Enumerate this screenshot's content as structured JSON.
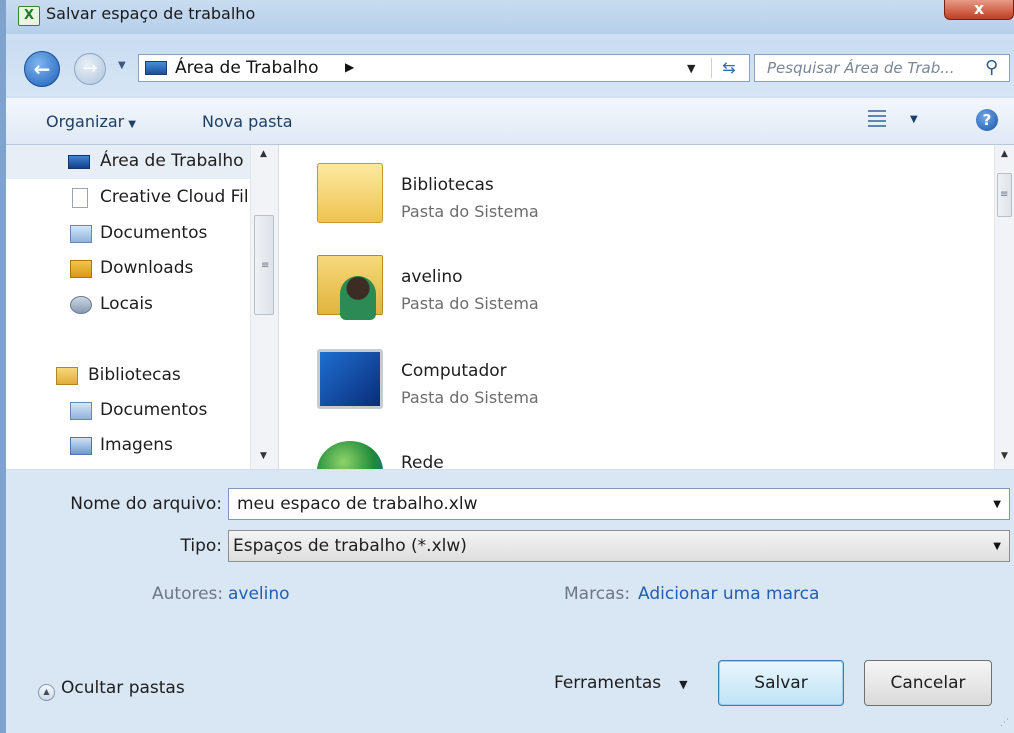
{
  "window": {
    "title": "Salvar espaço de trabalho",
    "app_icon": "X",
    "close_label": "x"
  },
  "nav": {
    "back": "←",
    "forward": "→",
    "address": "Área de Trabalho",
    "search_placeholder": "Pesquisar Área de Trab..."
  },
  "toolbar": {
    "organize": "Organizar",
    "new_folder": "Nova pasta",
    "help": "?"
  },
  "sidebar": {
    "items": [
      {
        "label": "Área de Trabalho",
        "icon": "desktop-icon"
      },
      {
        "label": "Creative Cloud Fil",
        "icon": "file-icon"
      },
      {
        "label": "Documentos",
        "icon": "documents-icon"
      },
      {
        "label": "Downloads",
        "icon": "downloads-icon"
      },
      {
        "label": "Locais",
        "icon": "places-icon"
      },
      {
        "label": "Bibliotecas",
        "icon": "libraries-icon"
      },
      {
        "label": "Documentos",
        "icon": "documents-icon"
      },
      {
        "label": "Imagens",
        "icon": "images-icon"
      }
    ]
  },
  "files": [
    {
      "name": "Bibliotecas",
      "type": "Pasta do Sistema",
      "icon": "libraries-icon"
    },
    {
      "name": "avelino",
      "type": "Pasta do Sistema",
      "icon": "user-folder-icon"
    },
    {
      "name": "Computador",
      "type": "Pasta do Sistema",
      "icon": "computer-icon"
    },
    {
      "name": "Rede",
      "type": "",
      "icon": "network-icon"
    }
  ],
  "form": {
    "filename_label": "Nome do arquivo:",
    "filename_value": "meu espaco de trabalho.xlw",
    "type_label": "Tipo:",
    "type_value": "Espaços de trabalho (*.xlw)",
    "authors_label": "Autores:",
    "authors_value": "avelino",
    "tags_label": "Marcas:",
    "tags_value": "Adicionar uma marca"
  },
  "footer": {
    "hide_folders": "Ocultar pastas",
    "tools": "Ferramentas",
    "save": "Salvar",
    "cancel": "Cancelar"
  }
}
